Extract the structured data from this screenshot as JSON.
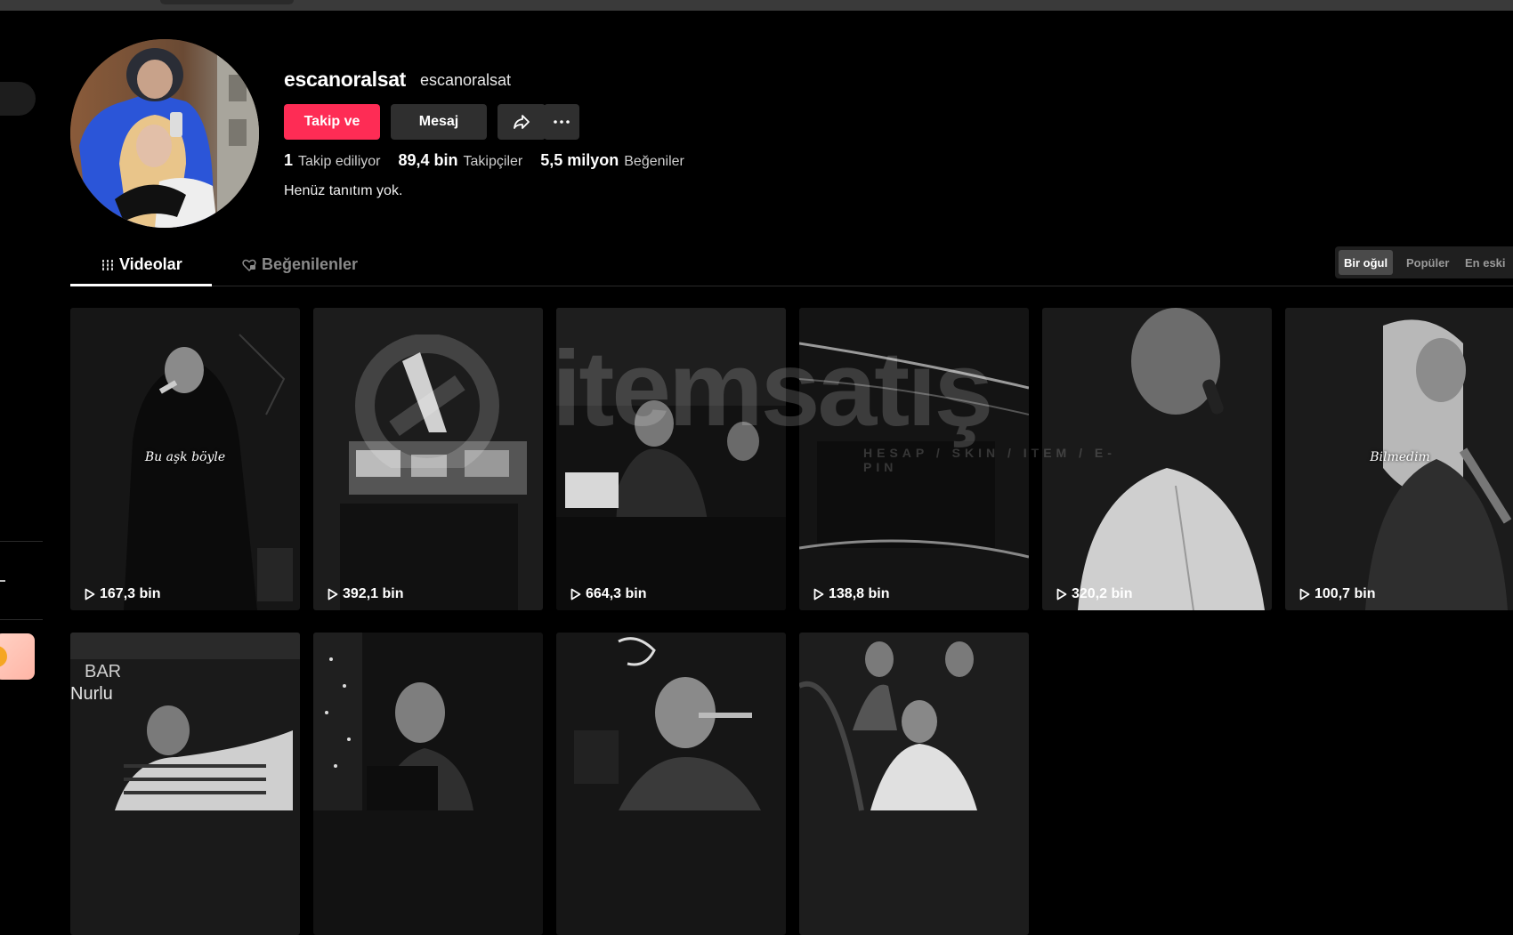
{
  "profile": {
    "username": "escanoralsat",
    "nickname": "escanoralsat",
    "follow_label": "Takip ve",
    "message_label": "Mesaj",
    "bio": "Henüz tanıtım yok.",
    "stats": [
      {
        "value": "1",
        "label": "Takip ediliyor"
      },
      {
        "value": "89,4 bin",
        "label": "Takipçiler"
      },
      {
        "value": "5,5 milyon",
        "label": "Beğeniler"
      }
    ]
  },
  "tabs": [
    {
      "label": "Videolar",
      "active": true
    },
    {
      "label": "Beğenilenler",
      "active": false
    }
  ],
  "sort_options": [
    {
      "label": "Bir oğul",
      "active": true
    },
    {
      "label": "Popüler",
      "active": false
    },
    {
      "label": "En eski",
      "active": false
    }
  ],
  "videos": [
    {
      "views": "167,3 bin",
      "caption": "Bu aşk böyle"
    },
    {
      "views": "392,1 bin",
      "caption": ""
    },
    {
      "views": "664,3 bin",
      "caption": ""
    },
    {
      "views": "138,8 bin",
      "caption": ""
    },
    {
      "views": "320,2 bin",
      "caption": ""
    },
    {
      "views": "100,7 bin",
      "caption": "Bilmedim"
    },
    {
      "views": "",
      "caption": ""
    },
    {
      "views": "",
      "caption": ""
    },
    {
      "views": "",
      "caption": ""
    },
    {
      "views": "",
      "caption": ""
    }
  ],
  "watermark": {
    "brand": "itemsatış",
    "tagline": "HESAP / SKIN / ITEM / E-PIN"
  },
  "colors": {
    "accent": "#fe2c55",
    "background": "#000000",
    "button_secondary": "#2f2f2f"
  }
}
